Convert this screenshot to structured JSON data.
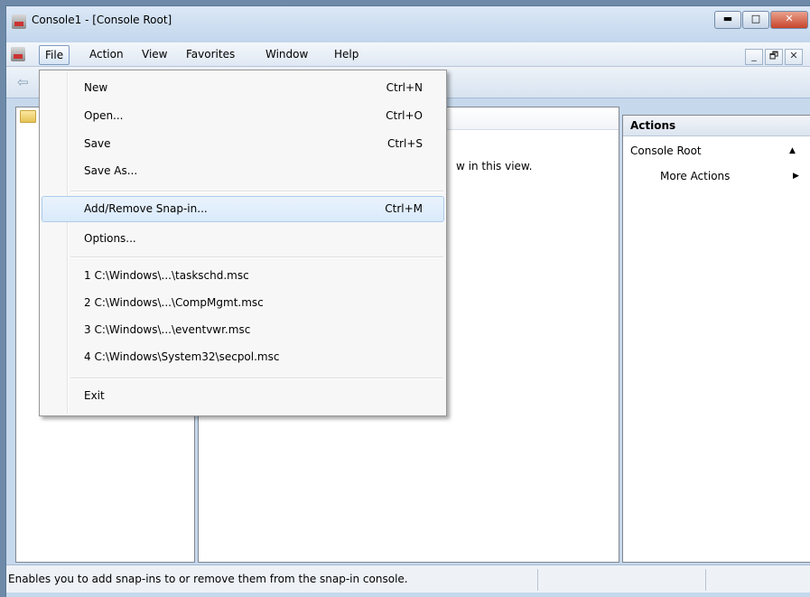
{
  "window": {
    "title": "Console1 - [Console Root]",
    "caption_buttons": {
      "minimize": "▬",
      "maximize": "□",
      "close": "✕"
    },
    "mdi_buttons": {
      "minimize": "_",
      "restore": "🗗",
      "close": "✕"
    }
  },
  "menubar": {
    "items": [
      {
        "label": "File"
      },
      {
        "label": "Action"
      },
      {
        "label": "View"
      },
      {
        "label": "Favorites"
      },
      {
        "label": "Window"
      },
      {
        "label": "Help"
      }
    ]
  },
  "file_menu": {
    "items": [
      {
        "label": "New",
        "shortcut": "Ctrl+N"
      },
      {
        "label": "Open...",
        "shortcut": "Ctrl+O"
      },
      {
        "label": "Save",
        "shortcut": "Ctrl+S"
      },
      {
        "label": "Save As...",
        "shortcut": ""
      },
      {
        "label": "Add/Remove Snap-in...",
        "shortcut": "Ctrl+M"
      },
      {
        "label": "Options...",
        "shortcut": ""
      },
      {
        "label": "1 C:\\Windows\\...\\taskschd.msc",
        "shortcut": ""
      },
      {
        "label": "2 C:\\Windows\\...\\CompMgmt.msc",
        "shortcut": ""
      },
      {
        "label": "3 C:\\Windows\\...\\eventvwr.msc",
        "shortcut": ""
      },
      {
        "label": "4 C:\\Windows\\System32\\secpol.msc",
        "shortcut": ""
      },
      {
        "label": "Exit",
        "shortcut": ""
      }
    ]
  },
  "main_pane": {
    "empty_text_fragment": "w in this view."
  },
  "actions_pane": {
    "title": "Actions",
    "section": "Console Root",
    "more_actions": "More Actions",
    "collapse_glyph": "▲",
    "more_glyph": "▶"
  },
  "statusbar": {
    "text": "Enables you to add snap-ins to or remove them from the snap-in console."
  },
  "icons": {
    "back": "back-arrow-icon",
    "folder": "folder-icon",
    "app": "mmc-console-icon"
  },
  "colors": {
    "menu_hover": "#d9eafb",
    "frame": "#c6d8ec"
  }
}
